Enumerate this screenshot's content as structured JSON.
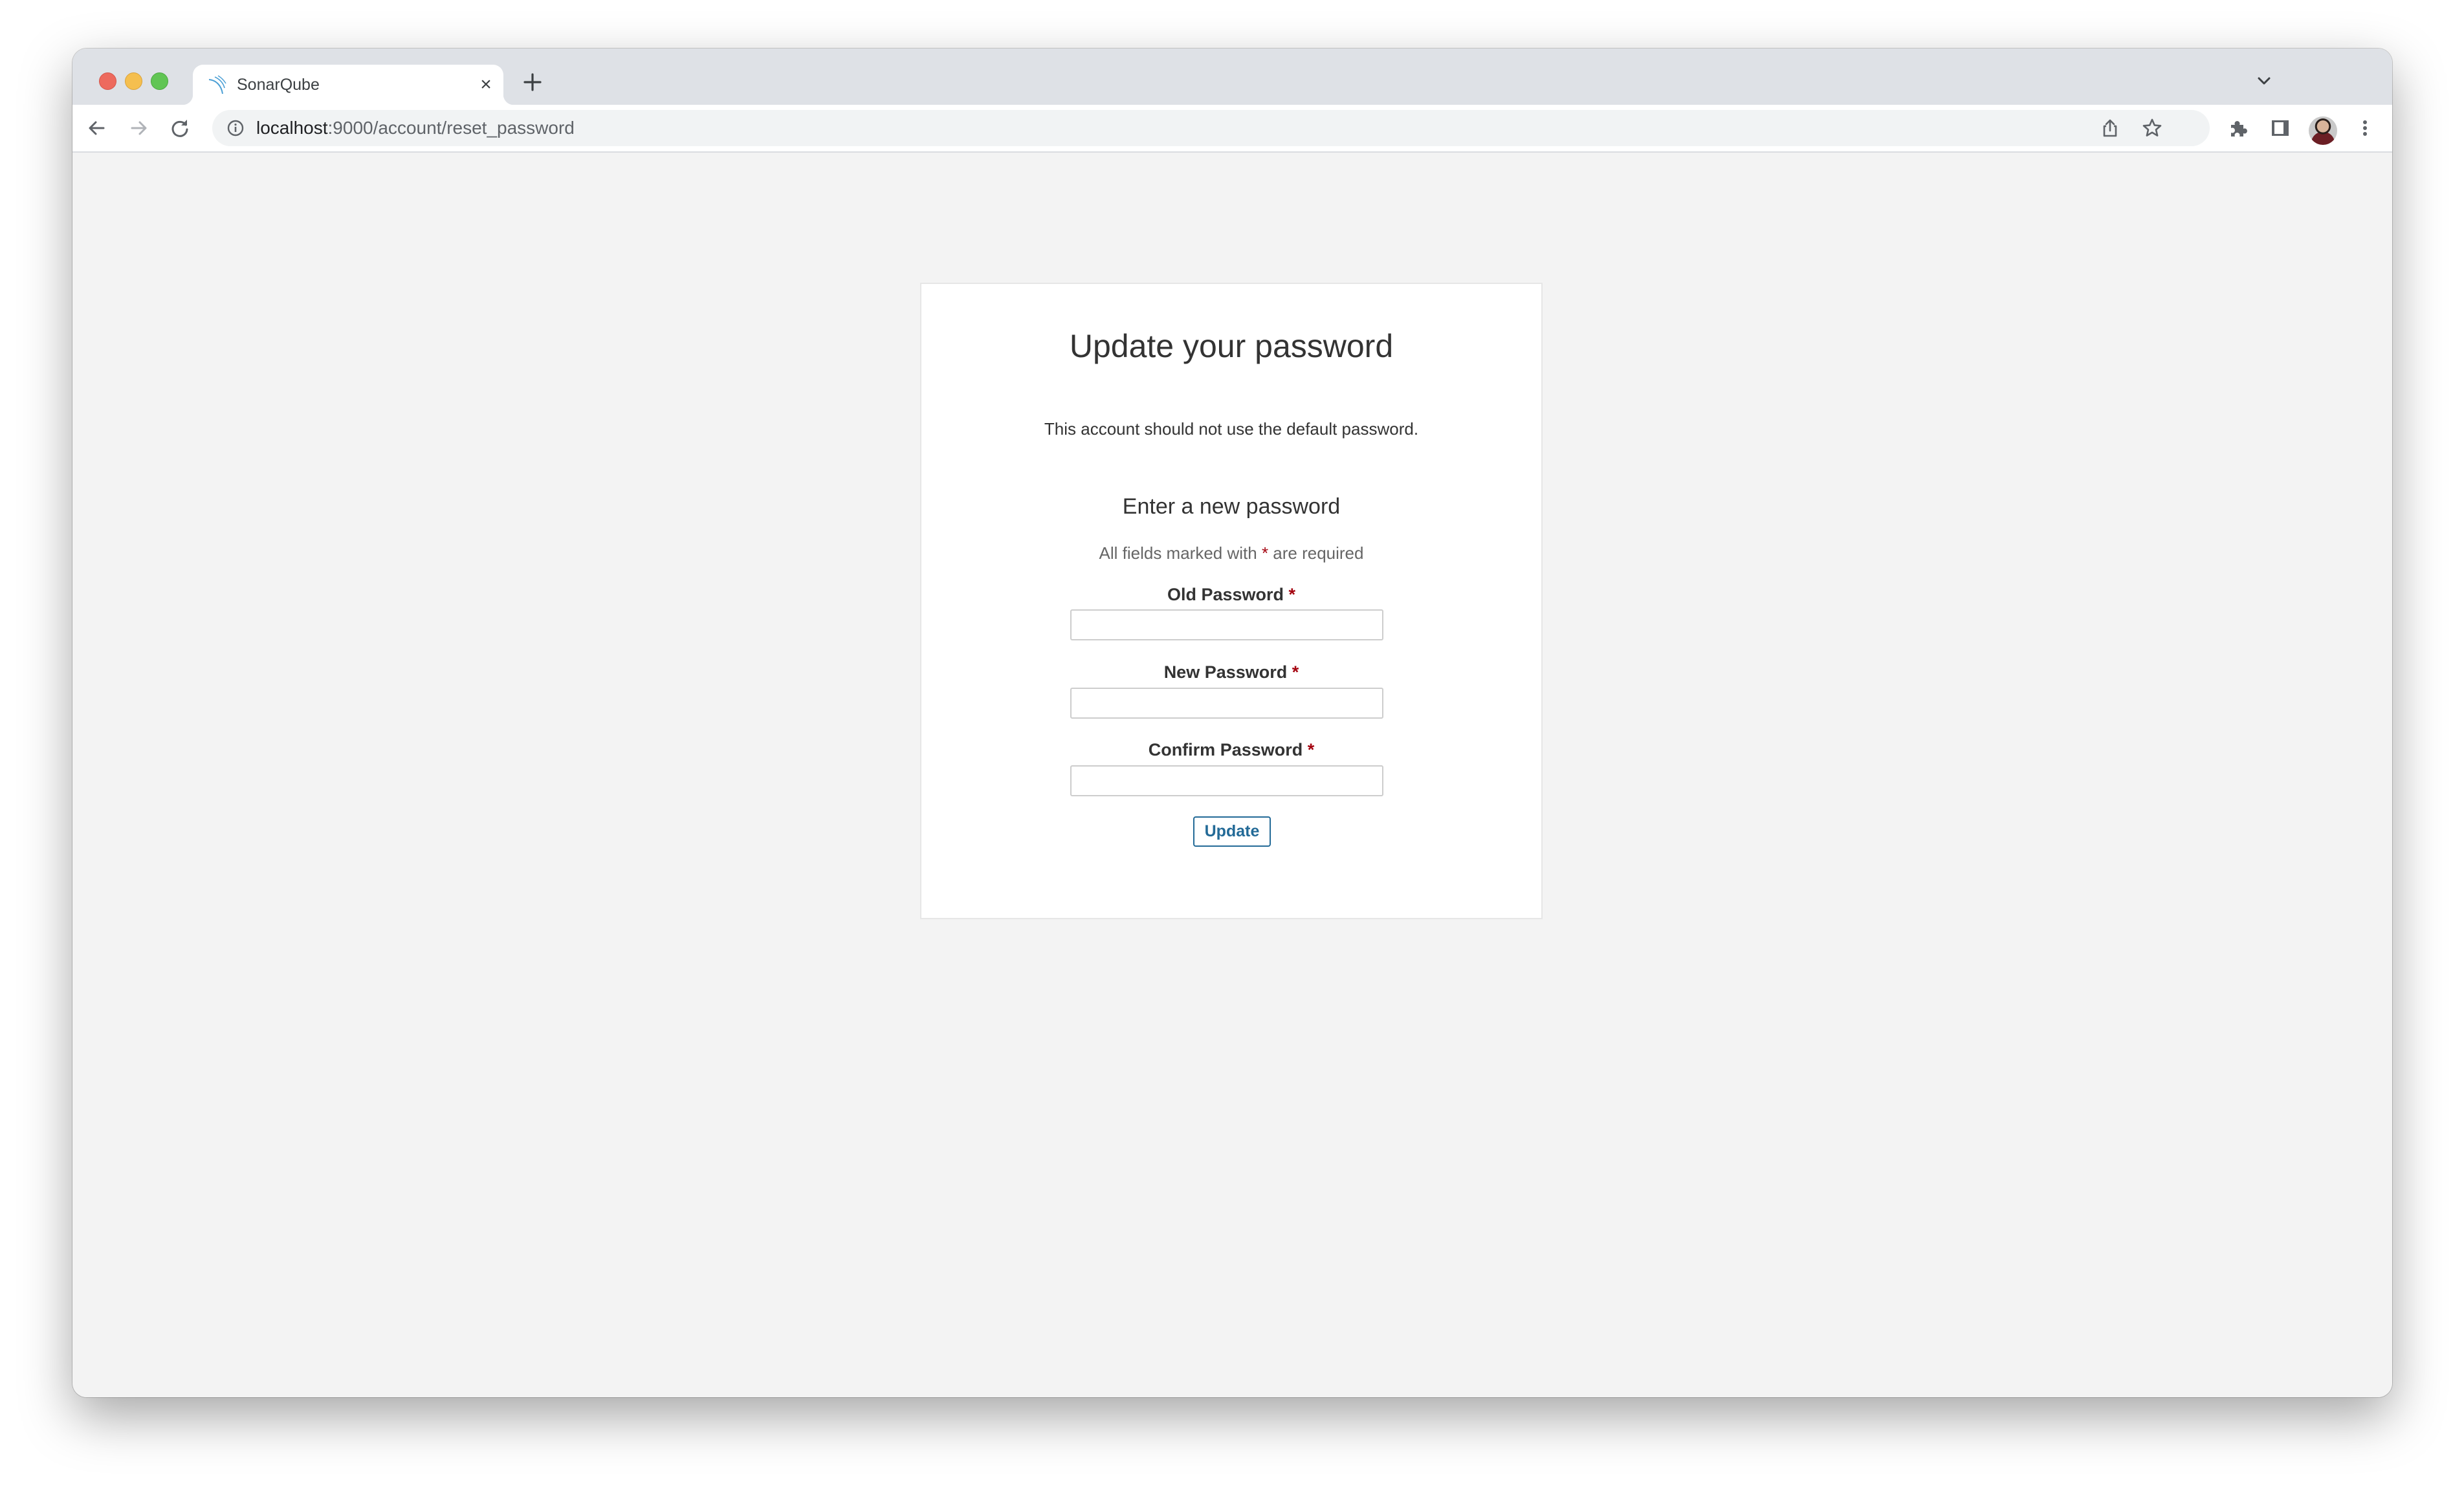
{
  "browser": {
    "tab": {
      "title": "SonarQube",
      "favicon": "sonarqube-logo-icon",
      "close_glyph": "×"
    },
    "address_bar": {
      "host": "localhost",
      "path": ":9000/account/reset_password"
    },
    "icons": {
      "back": "arrow-left-icon",
      "forward": "arrow-right-icon",
      "reload": "reload-icon",
      "site_info": "info-icon",
      "share": "share-icon",
      "bookmark": "star-icon",
      "extensions": "puzzle-icon",
      "side_panel": "side-panel-icon",
      "profile": "avatar",
      "menu": "kebab-menu-icon",
      "new_tab": "plus-icon",
      "tab_list": "chevron-down-icon"
    },
    "colors": {
      "tabstrip": "#dee1e6",
      "url_bar": "#f1f3f4",
      "page_bg": "#f3f3f3"
    }
  },
  "page": {
    "title": "Update your password",
    "message": "This account should not use the default password.",
    "subtitle": "Enter a new password",
    "required_note": {
      "prefix": "All fields marked with ",
      "marker": "*",
      "suffix": " are required"
    },
    "fields": [
      {
        "label": "Old Password",
        "required_marker": "*",
        "value": "",
        "type": "password"
      },
      {
        "label": "New Password",
        "required_marker": "*",
        "value": "",
        "type": "password"
      },
      {
        "label": "Confirm Password",
        "required_marker": "*",
        "value": "",
        "type": "password"
      }
    ],
    "submit_label": "Update",
    "colors": {
      "required": "#a4030f",
      "primary": "#236a97",
      "text": "#333333",
      "muted": "#666666"
    }
  }
}
